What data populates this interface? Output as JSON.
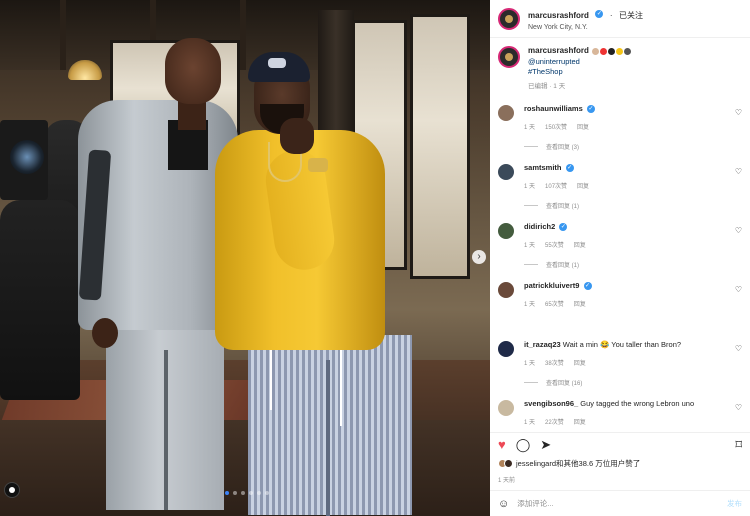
{
  "post": {
    "author": "marcusrashford",
    "location": "New York City, N.Y.",
    "follow_status": "已关注",
    "caption": {
      "mention": "@uninterrupted",
      "hashtag": "#TheShop",
      "meta": "已编辑 · 1 天"
    }
  },
  "comments": [
    {
      "user": "roshaunwilliams",
      "verified": true,
      "text": "",
      "time": "1 天",
      "likes": "150次赞",
      "reply": "回复",
      "more": "查看回复 (3)",
      "avatar_color": "#8a6f5c"
    },
    {
      "user": "samtsmith",
      "verified": true,
      "text": "",
      "time": "1 天",
      "likes": "107次赞",
      "reply": "回复",
      "more": "查看回复 (1)",
      "avatar_color": "#3b4a5a"
    },
    {
      "user": "didirich2",
      "verified": true,
      "text": "",
      "time": "1 天",
      "likes": "55次赞",
      "reply": "回复",
      "more": "查看回复 (1)",
      "avatar_color": "#445c3e"
    },
    {
      "user": "patrickkluivert9",
      "verified": true,
      "text": "",
      "time": "1 天",
      "likes": "65次赞",
      "reply": "回复",
      "more": "",
      "avatar_color": "#6a4a3a"
    },
    {
      "user": "it_razaq23",
      "verified": false,
      "text": "Wait a min 😂 You taller than Bron?",
      "time": "1 天",
      "likes": "38次赞",
      "reply": "回复",
      "more": "查看回复 (16)",
      "avatar_color": "#1f2a48"
    },
    {
      "user": "svengibson96_",
      "verified": false,
      "text": "Guy tagged the wrong Lebron uno",
      "time": "1 天",
      "likes": "22次赞",
      "reply": "回复",
      "more": "查看回复 (5)",
      "avatar_color": "#c8b9a0"
    }
  ],
  "icons": {
    "like": "heart-icon",
    "comment": "comment-icon",
    "share": "share-icon",
    "save": "bookmark-icon",
    "emoji": "smile-icon",
    "comment_like": "heart-outline-icon"
  },
  "likes_text": "jesselingard和其他38.6 万位用户赞了",
  "post_time": "1 天前",
  "add_comment": {
    "placeholder": "添加评论...",
    "post_label": "发布"
  },
  "colors": {
    "accent": "#3897f0",
    "liked": "#ed4956",
    "muted": "#8e8e8e"
  }
}
